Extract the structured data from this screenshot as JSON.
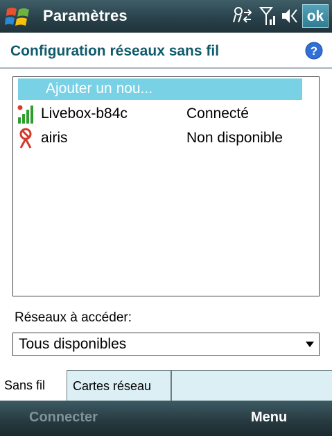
{
  "titlebar": {
    "title": "Paramètres",
    "ok_label": "ok"
  },
  "header": {
    "title": "Configuration réseaux sans fil"
  },
  "network_list": {
    "add_item": "Ajouter un nou...",
    "networks": [
      {
        "name": "Livebox-b84c",
        "status": "Connecté",
        "icon": "signal-bars-icon"
      },
      {
        "name": "airis",
        "status": "Non disponible",
        "icon": "unavailable-network-icon"
      }
    ]
  },
  "access": {
    "label": "Réseaux à accéder:",
    "selected": "Tous disponibles"
  },
  "tabs": [
    {
      "label": "Sans fil"
    },
    {
      "label": "Cartes réseau"
    }
  ],
  "softkeys": {
    "left": "Connecter",
    "right": "Menu"
  },
  "colors": {
    "titlebar": "#29424b",
    "accent_text": "#0f5b6b",
    "selection": "#79d1e6",
    "tab_inactive": "#dceff5"
  }
}
